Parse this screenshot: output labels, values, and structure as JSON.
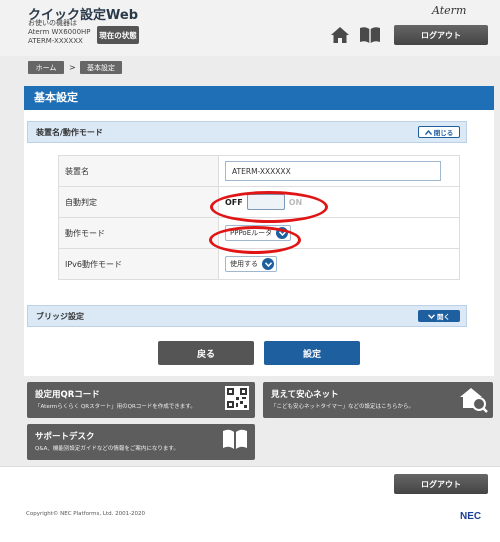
{
  "header": {
    "app_title": "クイック設定Web",
    "device_caption": "お使いの機器は",
    "device_model": "Aterm WX6000HP",
    "device_name": "ATERM-XXXXXX",
    "status_button": "現在の状態",
    "brand": "Aterm",
    "logout_label": "ログアウト"
  },
  "breadcrumb": {
    "home": "ホーム",
    "separator": ">",
    "current": "基本設定"
  },
  "panel": {
    "title": "基本設定",
    "section1": {
      "label": "装置名/動作モード",
      "toggle_label": "閉じる"
    },
    "rows": [
      {
        "label": "装置名",
        "value": "ATERM-XXXXXX"
      },
      {
        "label": "自動判定",
        "off_label": "OFF",
        "on_label": "ON"
      },
      {
        "label": "動作モード",
        "selected": "PPPoEルータ"
      },
      {
        "label": "IPv6動作モード",
        "selected": "使用する"
      }
    ],
    "section2": {
      "label": "ブリッジ設定",
      "toggle_label": "開く"
    },
    "back_button": "戻る",
    "submit_button": "設定"
  },
  "cards": {
    "qr": {
      "title": "設定用QRコード",
      "desc": "「Atermらくらく QRスタート」用のQRコードを作成できます。"
    },
    "mieru": {
      "title": "見えて安心ネット",
      "desc": "「こども安心ネットタイマー」などの設定はこちらから。"
    },
    "support": {
      "title": "サポートデスク",
      "desc": "Q&A、機能別設定ガイドなどの情報をご案内になります。"
    }
  },
  "footer": {
    "logout_label": "ログアウト",
    "copyright": "Copyright© NEC Platforms, Ltd. 2001-2020",
    "logo": "NEC"
  },
  "colors": {
    "primary": "#1e6fb5",
    "highlight": "#e01515",
    "dark_button": "#555555"
  }
}
